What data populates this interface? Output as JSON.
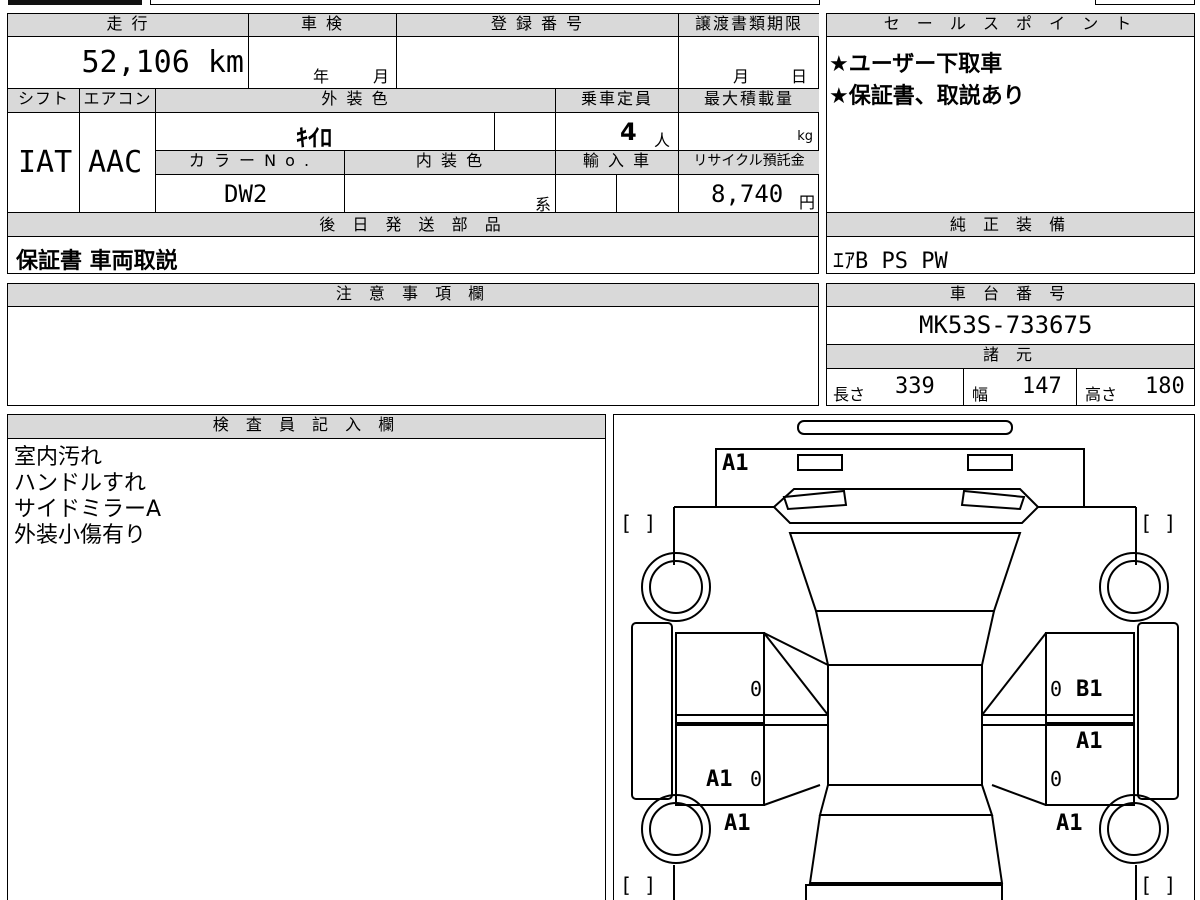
{
  "top": {
    "mileage_header": "走 行",
    "mileage_value": "52,106 km",
    "shaken_header": "車 検",
    "shaken_year": "年",
    "shaken_month": "月",
    "reg_header": "登 録 番 号",
    "transfer_header": "譲渡書類期限",
    "transfer_month": "月",
    "transfer_day": "日",
    "shift_header": "シフト",
    "shift_value": "IAT",
    "aircon_header": "エアコン",
    "aircon_value": "AAC",
    "exterior_header": "外 装 色",
    "exterior_value": "ｷｲﾛ",
    "capacity_header": "乗車定員",
    "capacity_value": "4",
    "capacity_unit": "人",
    "maxload_header": "最大積載量",
    "maxload_unit": "kg",
    "colorno_header": "カ ラ ー N o .",
    "colorno_value": "DW2",
    "interior_header": "内 装 色",
    "interior_unit": "系",
    "import_header": "輸 入 車",
    "recycle_header": "リサイクル預託金",
    "recycle_value": "8,740",
    "recycle_unit": "円"
  },
  "later_parts": {
    "header": "後 日 発 送 部 品",
    "value": "保証書 車両取説"
  },
  "sales_point": {
    "header": "セ ー ル ス ポ イ ン ト",
    "lines": [
      "★ユーザー下取車",
      "★保証書、取説あり"
    ]
  },
  "genuine_equipment": {
    "header": "純 正 装 備",
    "value": "ｴｱB PS PW"
  },
  "caution": {
    "header": "注 意 事 項 欄"
  },
  "chassis": {
    "header": "車 台 番 号",
    "value": "MK53S-733675"
  },
  "specs": {
    "header": "諸 元",
    "length_label": "長さ",
    "length_value": "339",
    "width_label": "幅",
    "width_value": "147",
    "height_label": "高さ",
    "height_value": "180"
  },
  "inspector": {
    "header": "検 査 員 記 入 欄",
    "lines": [
      "室内汚れ",
      "ハンドルすれ",
      "サイドミラーA",
      "外装小傷有り"
    ]
  },
  "diagram": {
    "marks": {
      "front_bumper": "A1",
      "right_rear_door": "B1",
      "right_door": "A1",
      "left_rear_door": "A1",
      "left_rear_wheel": "A1",
      "right_rear_wheel": "A1",
      "zero_left_upper": "0",
      "zero_left_lower": "0",
      "zero_right_upper": "0",
      "zero_right_lower": "0"
    },
    "brackets": "[ ]"
  }
}
